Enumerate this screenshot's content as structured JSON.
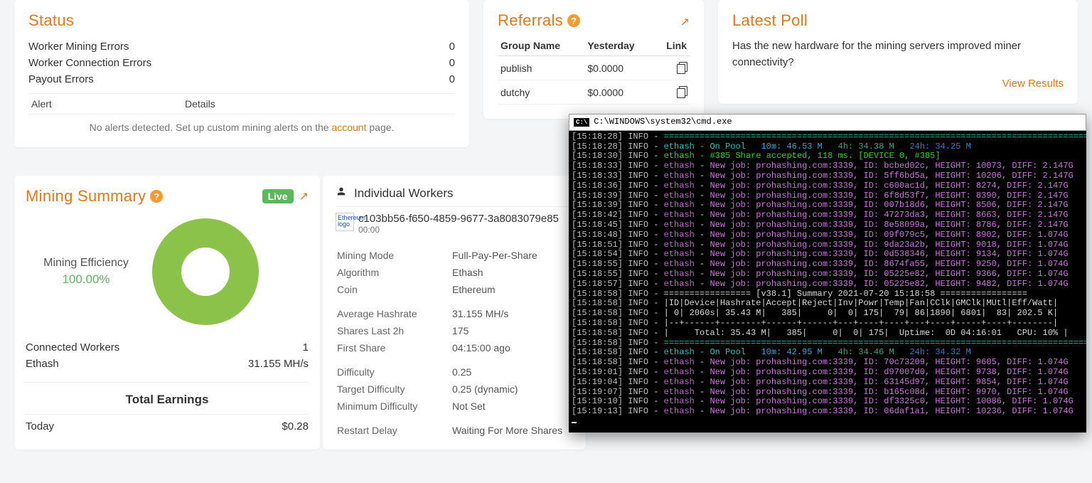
{
  "status": {
    "title": "Status",
    "rows": [
      {
        "label": "Worker Mining Errors",
        "value": "0"
      },
      {
        "label": "Worker Connection Errors",
        "value": "0"
      },
      {
        "label": "Payout Errors",
        "value": "0"
      }
    ],
    "alert_col": "Alert",
    "details_col": "Details",
    "empty_prefix": "No alerts detected. Set up custom mining alerts on the ",
    "empty_link": "account",
    "empty_suffix": " page."
  },
  "referrals": {
    "title": "Referrals",
    "cols": {
      "name": "Group Name",
      "yesterday": "Yesterday",
      "link": "Link"
    },
    "rows": [
      {
        "name": "publish",
        "yesterday": "$0.0000"
      },
      {
        "name": "dutchy",
        "yesterday": "$0.0000"
      }
    ]
  },
  "poll": {
    "title": "Latest Poll",
    "question": "Has the new hardware for the mining servers improved miner connectivity?",
    "view": "View Results"
  },
  "mining": {
    "title": "Mining Summary",
    "live": "Live",
    "eff_label": "Mining Efficiency",
    "eff_value": "100.00%",
    "connected_label": "Connected Workers",
    "connected_value": "1",
    "algo_label": "Ethash",
    "algo_value": "31.155 MH/s",
    "total_earnings": "Total Earnings",
    "today_label": "Today",
    "today_value": "$0.28"
  },
  "workers": {
    "title": "Individual Workers",
    "coin_alt": "Ethereum logo",
    "id": "c103bb56-f650-4859-9677-3a8083079e85",
    "sub": "00:00",
    "details": [
      {
        "k": "Mining Mode",
        "v": "Full-Pay-Per-Share"
      },
      {
        "k": "Algorithm",
        "v": "Ethash"
      },
      {
        "k": "Coin",
        "v": "Ethereum"
      },
      {
        "k": "Average Hashrate",
        "v": "31.155 MH/s"
      },
      {
        "k": "Shares Last 2h",
        "v": "175"
      },
      {
        "k": "First Share",
        "v": "04:15:00 ago"
      },
      {
        "k": "Difficulty",
        "v": "0.25"
      },
      {
        "k": "Target Difficulty",
        "v": "0.25 (dynamic)"
      },
      {
        "k": "Minimum Difficulty",
        "v": "Not Set"
      },
      {
        "k": "Restart Delay",
        "v": "Waiting For More Shares"
      }
    ]
  },
  "cmd": {
    "title": "C:\\WINDOWS\\system32\\cmd.exe",
    "lines": [
      {
        "ts": "15:18:28",
        "t": "eq"
      },
      {
        "ts": "15:18:28",
        "t": "pool",
        "m10": "46.53 M",
        "m4": "34.38 M",
        "m24": "34.25 M"
      },
      {
        "ts": "15:18:30",
        "t": "share",
        "n": "385",
        "ms": "118",
        "dev": "DEVICE 0, #385"
      },
      {
        "ts": "15:18:33",
        "t": "job",
        "id": "bcbed02c",
        "h": "10073",
        "d": "2.147G"
      },
      {
        "ts": "15:18:33",
        "t": "job",
        "id": "5ff6bd5a",
        "h": "10206",
        "d": "2.147G"
      },
      {
        "ts": "15:18:36",
        "t": "job",
        "id": "c600ac1d",
        "h": "8274",
        "d": "2.147G"
      },
      {
        "ts": "15:18:39",
        "t": "job",
        "id": "6f8d53f7",
        "h": "8390",
        "d": "2.147G"
      },
      {
        "ts": "15:18:39",
        "t": "job",
        "id": "007b18d6",
        "h": "8506",
        "d": "2.147G"
      },
      {
        "ts": "15:18:42",
        "t": "job",
        "id": "47273da3",
        "h": "8663",
        "d": "2.147G"
      },
      {
        "ts": "15:18:45",
        "t": "job",
        "id": "8e58099a",
        "h": "8786",
        "d": "2.147G"
      },
      {
        "ts": "15:18:48",
        "t": "job",
        "id": "09f079c5",
        "h": "8902",
        "d": "1.074G"
      },
      {
        "ts": "15:18:51",
        "t": "job",
        "id": "9da23a2b",
        "h": "9018",
        "d": "1.074G"
      },
      {
        "ts": "15:18:54",
        "t": "job",
        "id": "0d538346",
        "h": "9134",
        "d": "1.074G"
      },
      {
        "ts": "15:18:55",
        "t": "job",
        "id": "8674fa55",
        "h": "9250",
        "d": "1.074G"
      },
      {
        "ts": "15:18:55",
        "t": "job",
        "id": "05225e82",
        "h": "9366",
        "d": "1.074G"
      },
      {
        "ts": "15:18:57",
        "t": "job",
        "id": "05225e82",
        "h": "9482",
        "d": "1.074G"
      },
      {
        "ts": "15:18:58",
        "t": "sumhdr",
        "v": "[v38.1] Summary 2021-07-20 15:18:58"
      },
      {
        "ts": "15:18:58",
        "t": "tblhdr"
      },
      {
        "ts": "15:18:58",
        "t": "tblrow",
        "dev": "2060s",
        "hr": "35.43 M",
        "acc": "385",
        "rej": "0",
        "inv": "0",
        "pw": "175",
        "tmp": "79",
        "fan": "86",
        "cclk": "1890",
        "gmclk": "6801",
        "mutl": "83",
        "eff": "202.5 K"
      },
      {
        "ts": "15:18:58",
        "t": "tbldiv"
      },
      {
        "ts": "15:18:58",
        "t": "tbltot",
        "hr": "35.43 M",
        "acc": "385",
        "rej": "0",
        "inv": "0",
        "pw": "175",
        "up": "0D 04:16:01",
        "cpu": "10%"
      },
      {
        "ts": "15:18:58",
        "t": "eq"
      },
      {
        "ts": "15:18:58",
        "t": "pool",
        "m10": "42.95 M",
        "m4": "34.46 M",
        "m24": "34.32 M"
      },
      {
        "ts": "15:18:58",
        "t": "job",
        "id": "70c73209",
        "h": "9605",
        "d": "1.074G"
      },
      {
        "ts": "15:19:01",
        "t": "job",
        "id": "d97007d0",
        "h": "9738",
        "d": "1.074G"
      },
      {
        "ts": "15:19:04",
        "t": "job",
        "id": "63145d97",
        "h": "9854",
        "d": "1.074G"
      },
      {
        "ts": "15:19:07",
        "t": "job",
        "id": "b165c08d",
        "h": "9970",
        "d": "1.074G"
      },
      {
        "ts": "15:19:10",
        "t": "job",
        "id": "df3325c0",
        "h": "10086",
        "d": "1.074G"
      },
      {
        "ts": "15:19:13",
        "t": "job",
        "id": "06daf1a1",
        "h": "10236",
        "d": "1.074G"
      }
    ]
  }
}
